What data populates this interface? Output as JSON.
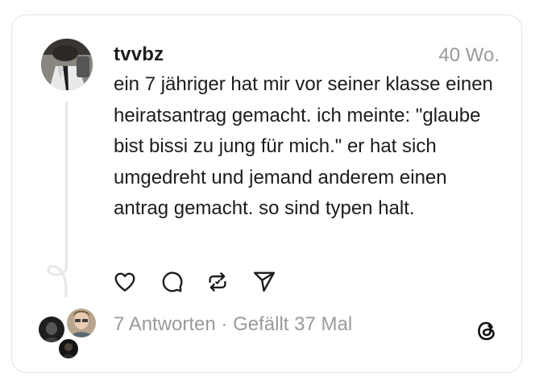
{
  "post": {
    "username": "tvvbz",
    "time": "40 Wo.",
    "text": "ein 7 jähriger hat mir vor seiner klasse einen heiratsantrag gemacht. ich meinte: \"glaube bist bissi zu jung für mich.\" er hat sich umgedreht und jemand anderem einen antrag gemacht. so sind typen halt."
  },
  "stats": {
    "replies": "7 Antworten",
    "separator": " · ",
    "likes": "Gefällt 37 Mal"
  },
  "icons": {
    "like": "heart-icon",
    "comment": "comment-icon",
    "repost": "repost-icon",
    "share": "send-icon",
    "brand": "threads-logo-icon"
  },
  "colors": {
    "text": "#1c1c1c",
    "muted": "#9a9a9a",
    "border": "#e3e3e3"
  }
}
